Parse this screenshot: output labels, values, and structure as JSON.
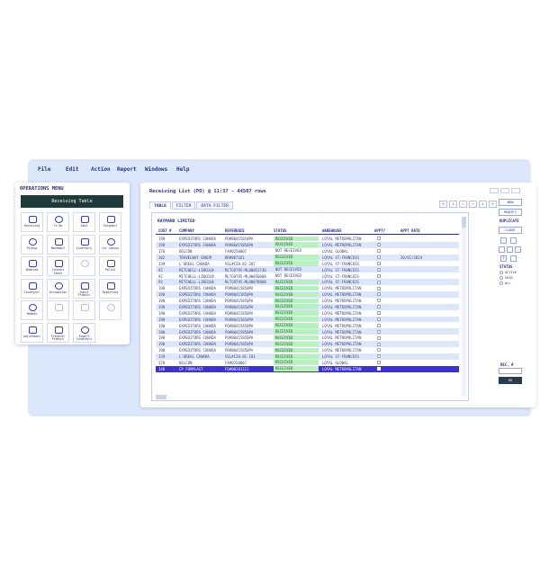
{
  "menubar": [
    "File",
    "Edit",
    "Action",
    "Report",
    "Windows",
    "Help"
  ],
  "window_title": "Receiving List (PO) @ 11:37 - 44507 rows",
  "tabs": [
    "TABLE",
    "FILTER",
    "DATA FILTER"
  ],
  "pager": [
    "<",
    "«",
    "‹",
    "›",
    "»",
    ">"
  ],
  "group_label": "RAYMAND LIMITED",
  "columns": [
    "CUST #",
    "COMPANY",
    "REFERENCE",
    "STATUS",
    "WAREHOUSE",
    "APPT?",
    "APPT DATE"
  ],
  "rows": [
    [
      "190",
      "EXPEDITORS CANADA",
      "PO#80415850PA",
      "RECEIVED",
      "LOYAL METROPOLITAN",
      "",
      ""
    ],
    [
      "190",
      "EXPEDITORS CANADA",
      "PO#80415850PA",
      "RECEIVED",
      "LOYAL METROPOLITAN",
      "",
      ""
    ],
    [
      "170",
      "DELCON",
      "FA#0250007",
      "NOT RECEIVED",
      "LOYAL GLOBAL",
      "",
      ""
    ],
    [
      "102",
      "TRAVELWAY GROUP",
      "BR#007261",
      "RECEIVED",
      "LOYAL ST-FRANCOIS",
      "",
      "20/01/2024"
    ],
    [
      "139",
      "L'OREAL CANADA",
      "VSL#CZ8-01-207",
      "RECEIVED",
      "LOYAL ST-FRANCOIS",
      "",
      ""
    ],
    [
      "92",
      "MITCHELL-LINCOLN",
      "MLTG9795-MLOH052736",
      "NOT RECEIVED",
      "LOYAL ST-FRANCOIS",
      "",
      ""
    ],
    [
      "92",
      "MITCHELL-LINCOLN",
      "MLTG9795-MLOH050600",
      "NOT RECEIVED",
      "LOYAL ST-FRANCOIS",
      "",
      ""
    ],
    [
      "92",
      "MITCHELL-LINCOLN",
      "MLTG9795-MLOH078000",
      "RECEIVED",
      "LOYAL ST-FRANCOIS",
      "",
      ""
    ],
    [
      "190",
      "EXPEDITORS CANADA",
      "PO#80415850PA",
      "RECEIVED",
      "LOYAL METROPOLITAN",
      "",
      ""
    ],
    [
      "190",
      "EXPEDITORS CANADA",
      "PO#80415850PA",
      "RECEIVED",
      "LOYAL METROPOLITAN",
      "",
      ""
    ],
    [
      "190",
      "EXPEDITORS CANADA",
      "PO#80415850PA",
      "RECEIVED",
      "LOYAL METROPOLITAN",
      "",
      ""
    ],
    [
      "190",
      "EXPEDITORS CANADA",
      "PO#80415850PA",
      "RECEIVED",
      "LOYAL METROPOLITAN",
      "",
      ""
    ],
    [
      "190",
      "EXPEDITORS CANADA",
      "PO#80415850PA",
      "RECEIVED",
      "LOYAL METROPOLITAN",
      "",
      ""
    ],
    [
      "190",
      "EXPEDITORS CANADA",
      "PO#80415850PA",
      "RECEIVED",
      "LOYAL METROPOLITAN",
      "",
      ""
    ],
    [
      "190",
      "EXPEDITORS CANADA",
      "PO#80415850PA",
      "RECEIVED",
      "LOYAL METROPOLITAN",
      "",
      ""
    ],
    [
      "190",
      "EXPEDITORS CANADA",
      "PO#80415850PA",
      "RECEIVED",
      "LOYAL METROPOLITAN",
      "",
      ""
    ],
    [
      "190",
      "EXPEDITORS CANADA",
      "PO#80415850PA",
      "RECEIVED",
      "LOYAL METROPOLITAN",
      "",
      ""
    ],
    [
      "190",
      "EXPEDITORS CANADA",
      "PO#80415850PA",
      "RECEIVED",
      "LOYAL METROPOLITAN",
      "",
      ""
    ],
    [
      "190",
      "EXPEDITORS CANADA",
      "PO#80415850PA",
      "RECEIVED",
      "LOYAL METROPOLITAN",
      "",
      ""
    ],
    [
      "139",
      "L'OREAL CANADA",
      "VSL#CZ8-01-101",
      "RECEIVED",
      "LOYAL ST-FRANCOIS",
      "",
      ""
    ],
    [
      "170",
      "DELCON",
      "FA#0250007",
      "RECEIVED",
      "LOYAL GLOBAL",
      "",
      ""
    ],
    [
      "148",
      "CP FOMPLAST",
      "FO#00281211",
      "RECEIVED",
      "LOYAL METROPOLITAN",
      "",
      ""
    ]
  ],
  "selected_row_index": 21,
  "actions": {
    "new": "NEW",
    "modify": "MODIFY",
    "duplicate": "DUPLICATE",
    "close": "CLOSE",
    "status_label": "STATUS",
    "status_options": [
      "ACTIVE",
      "VOID",
      "ALL"
    ],
    "rec_label": "REC. #",
    "go": "GO",
    "help": "?"
  },
  "ops_menu": {
    "title": "OPERATIONS MENU",
    "header": "Receiving Table",
    "tiles": [
      {
        "label": "Receiving",
        "icon": "truck-icon"
      },
      {
        "label": "To Do",
        "icon": "checklist-icon"
      },
      {
        "label": "Appt",
        "icon": "calendar-icon"
      },
      {
        "label": "Shipment",
        "icon": "box-icon"
      },
      {
        "label": "Pickup",
        "icon": "truck-icon"
      },
      {
        "label": "Movement",
        "icon": "arrows-icon"
      },
      {
        "label": "Inventory",
        "icon": "shelves-icon"
      },
      {
        "label": "Cnt Lookup",
        "icon": "search-icon"
      },
      {
        "label": "Wheeled",
        "icon": "cart-icon"
      },
      {
        "label": "Contact Sheet",
        "icon": "contact-icon"
      },
      {
        "label": "",
        "icon": "camera-icon"
      },
      {
        "label": "Pallet",
        "icon": "pallet-icon"
      },
      {
        "label": "Container",
        "icon": "container-icon"
      },
      {
        "label": "Occupation",
        "icon": "occupation-icon"
      },
      {
        "label": "Audit Product",
        "icon": "sliders-icon"
      },
      {
        "label": "Reporting",
        "icon": "report-icon"
      },
      {
        "label": "Rebate",
        "icon": "rebate-icon"
      },
      {
        "label": "",
        "icon": "grid-icon"
      },
      {
        "label": "",
        "icon": "cross-icon"
      },
      {
        "label": "",
        "icon": "expand-icon"
      },
      {
        "label": "Adjustment",
        "icon": "adjust-icon"
      },
      {
        "label": "Transfer Product",
        "icon": "transfer-icon"
      },
      {
        "label": "Export Inventory",
        "icon": "export-icon"
      }
    ]
  }
}
